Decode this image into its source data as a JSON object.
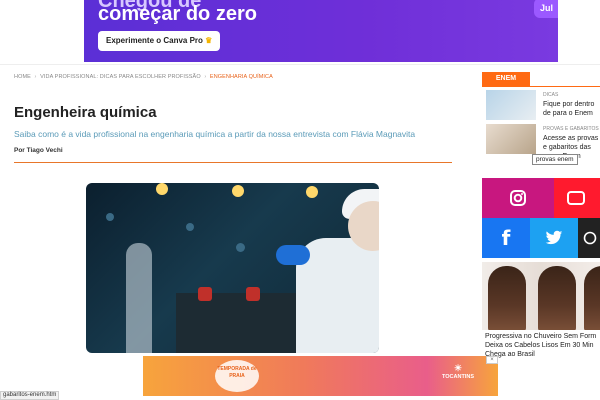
{
  "top_ad": {
    "headline1": "Chegou de",
    "headline2": "começar do zero",
    "button_label": "Experimente o Canva Pro",
    "badge": "Jul"
  },
  "breadcrumb": {
    "items": [
      "HOME",
      "VIDA PROFISSIONAL: DICAS PARA ESCOLHER PROFISSÃO",
      "ENGENHARIA QUÍMICA"
    ],
    "separator": "›"
  },
  "article": {
    "title": "Engenheira química",
    "subtitle": "Saiba como é a vida profissional na engenharia química a partir da nossa entrevista com Flávia Magnavita",
    "author": "Por Tiago Vechi"
  },
  "sidebar": {
    "enem_tab": "ENEM",
    "items": [
      {
        "category": "DICAS",
        "text": "Fique por dentro de para o Enem"
      },
      {
        "category": "PROVAS E GABARITOS",
        "text": "Acesse as provas e gabaritos das prova Enem"
      }
    ],
    "tooltip": "provas enem"
  },
  "social": [
    {
      "name": "instagram",
      "color": "#c8177f"
    },
    {
      "name": "youtube",
      "color": "#ff1a2e"
    },
    {
      "name": "facebook",
      "color": "#1876f2"
    },
    {
      "name": "twitter",
      "color": "#1da1f2"
    },
    {
      "name": "whatsapp",
      "color": "#222222"
    }
  ],
  "ad_card": {
    "text": "Progressiva no Chuveiro Sem Form Deixa os Cabelos Lisos Em 30 Min Chega ao Brasil"
  },
  "bottom_ad": {
    "left_logo": "TEMPORADA de PRAIA",
    "right_logo": "TOCANTINS",
    "close": "×"
  },
  "status_url": "gabaritos-enem.htm"
}
